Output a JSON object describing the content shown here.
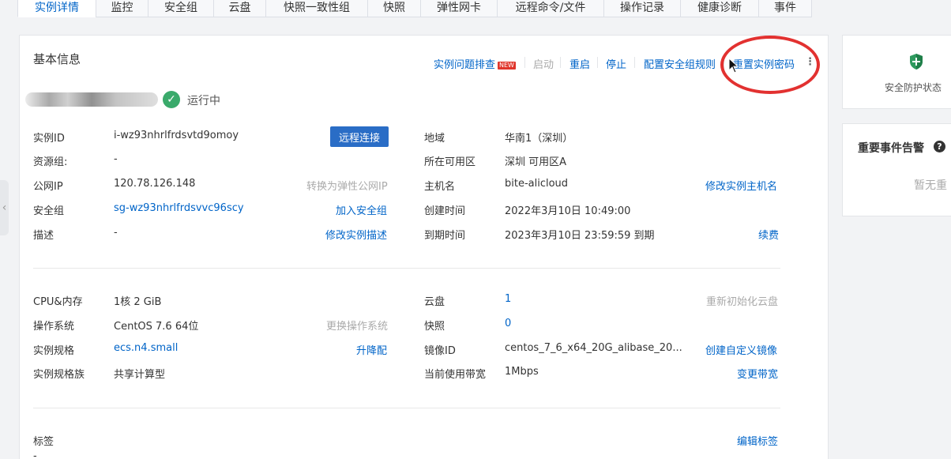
{
  "tabs": [
    {
      "label": "实例详情",
      "active": true
    },
    {
      "label": "监控"
    },
    {
      "label": "安全组"
    },
    {
      "label": "云盘"
    },
    {
      "label": "快照一致性组"
    },
    {
      "label": "快照"
    },
    {
      "label": "弹性网卡"
    },
    {
      "label": "远程命令/文件"
    },
    {
      "label": "操作记录"
    },
    {
      "label": "健康诊断"
    },
    {
      "label": "事件"
    }
  ],
  "basic": {
    "title": "基本信息",
    "actions": {
      "troubleshoot": "实例问题排查",
      "new_badge": "NEW",
      "start": "启动",
      "restart": "重启",
      "stop": "停止",
      "config_sg_rules": "配置安全组规则",
      "reset_password": "重置实例密码",
      "more": "⋮"
    },
    "status": "运行中",
    "remote_connect": "远程连接"
  },
  "info_left": {
    "instance_id": {
      "label": "实例ID",
      "value": "i-wz93nhrlfrdsvtd9omoy"
    },
    "resource_group": {
      "label": "资源组:",
      "value": "-"
    },
    "public_ip": {
      "label": "公网IP",
      "value": "120.78.126.148",
      "action": "转换为弹性公网IP"
    },
    "security_group": {
      "label": "安全组",
      "value": "sg-wz93nhrlfrdsvvc96scy",
      "action": "加入安全组"
    },
    "description": {
      "label": "描述",
      "value": "-",
      "action": "修改实例描述"
    }
  },
  "info_right": {
    "region": {
      "label": "地域",
      "value": "华南1（深圳）"
    },
    "zone": {
      "label": "所在可用区",
      "value": "深圳 可用区A"
    },
    "hostname": {
      "label": "主机名",
      "value": "bite-alicloud",
      "action": "修改实例主机名"
    },
    "created": {
      "label": "创建时间",
      "value": "2022年3月10日 10:49:00"
    },
    "expires": {
      "label": "到期时间",
      "value": "2023年3月10日 23:59:59 到期",
      "action": "续费"
    }
  },
  "config_left": {
    "cpu_mem": {
      "label": "CPU&内存",
      "value": "1核 2 GiB"
    },
    "os": {
      "label": "操作系统",
      "value": "CentOS 7.6 64位",
      "action": "更换操作系统"
    },
    "spec": {
      "label": "实例规格",
      "value": "ecs.n4.small",
      "action": "升降配"
    },
    "family": {
      "label": "实例规格族",
      "value": "共享计算型"
    }
  },
  "config_right": {
    "disk": {
      "label": "云盘",
      "value": "1",
      "action": "重新初始化云盘"
    },
    "snapshot": {
      "label": "快照",
      "value": "0"
    },
    "image": {
      "label": "镜像ID",
      "value": "centos_7_6_x64_20G_alibase_20...",
      "action": "创建自定义镜像"
    },
    "bandwidth": {
      "label": "当前使用带宽",
      "value": "1Mbps",
      "action": "变更带宽"
    }
  },
  "tags": {
    "label": "标签",
    "value": "-",
    "action": "编辑标签"
  },
  "right_panel": {
    "security_status": "安全防护状态",
    "events_title": "重要事件告警",
    "events_empty": "暂无重"
  },
  "colors": {
    "link": "#0064c8",
    "primary": "#2a6dc6",
    "success": "#3aaa6b",
    "annotation": "#e23130"
  }
}
